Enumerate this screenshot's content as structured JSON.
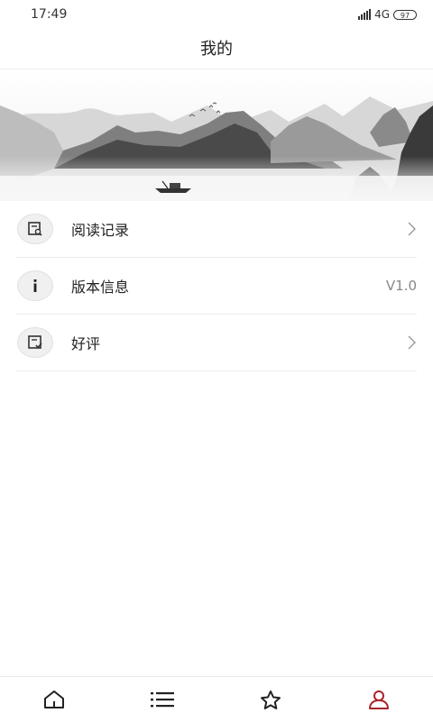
{
  "status_bar": {
    "time": "17:49",
    "network": "4G",
    "battery": "97"
  },
  "header": {
    "title": "我的"
  },
  "banner": {
    "description_icon": "ink-landscape-image"
  },
  "menu": {
    "items": [
      {
        "label": "阅读记录",
        "icon": "reading-record-icon",
        "right": "chevron"
      },
      {
        "label": "版本信息",
        "icon": "info-icon",
        "value": "V1.0"
      },
      {
        "label": "好评",
        "icon": "review-icon",
        "right": "chevron"
      }
    ]
  },
  "tabbar": {
    "tabs": [
      {
        "icon": "home-icon",
        "active": false
      },
      {
        "icon": "list-icon",
        "active": false
      },
      {
        "icon": "star-icon",
        "active": false
      },
      {
        "icon": "profile-icon",
        "active": true
      }
    ],
    "active_color": "#a8232b",
    "inactive_color": "#222222"
  }
}
